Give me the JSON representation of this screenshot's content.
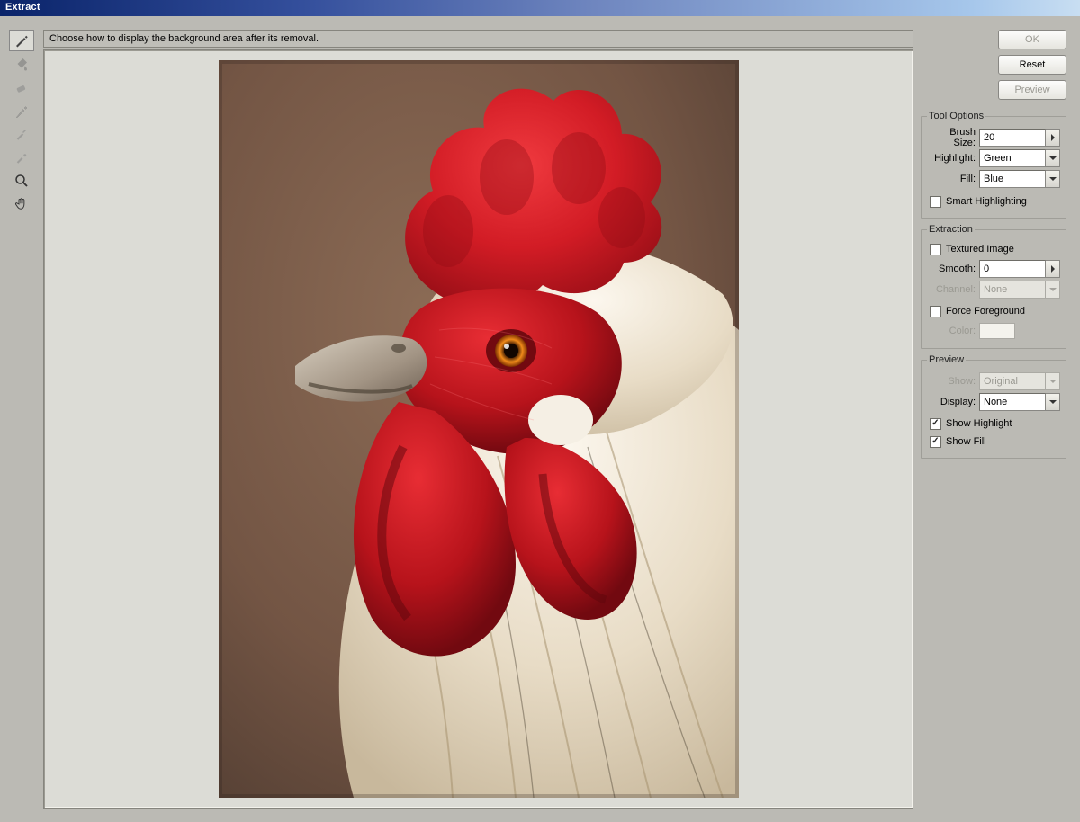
{
  "title": "Extract",
  "hint": "Choose how to display the background area after its removal.",
  "buttons": {
    "ok": "OK",
    "reset": "Reset",
    "preview": "Preview"
  },
  "toolOptions": {
    "legend": "Tool Options",
    "brushSize": {
      "label": "Brush Size:",
      "value": "20"
    },
    "highlight": {
      "label": "Highlight:",
      "value": "Green"
    },
    "fill": {
      "label": "Fill:",
      "value": "Blue"
    },
    "smartHighlighting": {
      "label": "Smart Highlighting",
      "checked": false
    }
  },
  "extraction": {
    "legend": "Extraction",
    "texturedImage": {
      "label": "Textured Image",
      "checked": false
    },
    "smooth": {
      "label": "Smooth:",
      "value": "0"
    },
    "channel": {
      "label": "Channel:",
      "value": "None"
    },
    "forceForeground": {
      "label": "Force Foreground",
      "checked": false
    },
    "color": {
      "label": "Color:"
    }
  },
  "preview": {
    "legend": "Preview",
    "show": {
      "label": "Show:",
      "value": "Original"
    },
    "display": {
      "label": "Display:",
      "value": "None"
    },
    "showHighlight": {
      "label": "Show Highlight",
      "checked": true
    },
    "showFill": {
      "label": "Show Fill",
      "checked": true
    }
  }
}
